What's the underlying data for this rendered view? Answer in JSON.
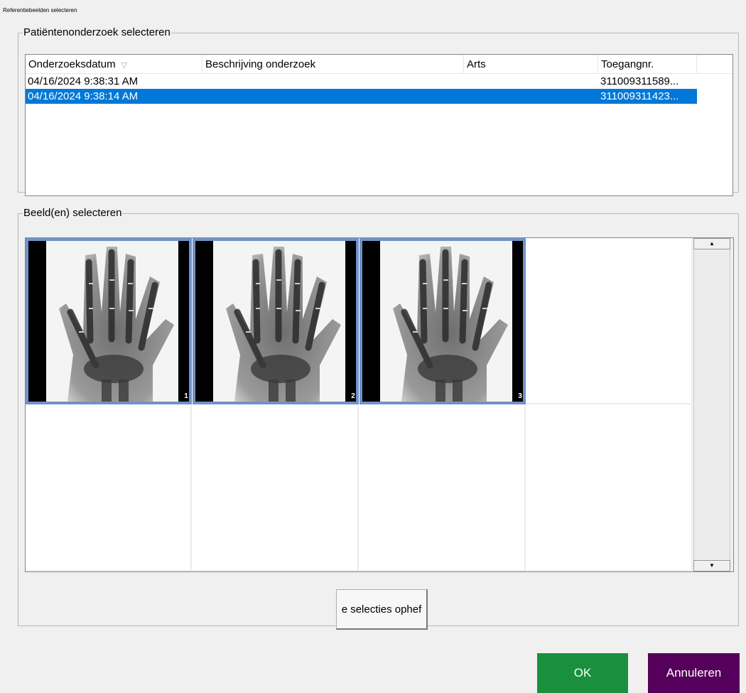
{
  "window": {
    "title": "Referentiebeelden selecteren"
  },
  "study_group": {
    "legend": "Patiëntenonderzoek selecteren",
    "columns": [
      {
        "label": "Onderzoeksdatum",
        "sort_icon": "sort-descending-icon"
      },
      {
        "label": "Beschrijving onderzoek"
      },
      {
        "label": "Arts"
      },
      {
        "label": "Toegangnr."
      }
    ],
    "rows": [
      {
        "date": "04/16/2024 9:38:31 AM",
        "description": "",
        "physician": "",
        "accession": "311009311589...",
        "selected": false
      },
      {
        "date": "04/16/2024 9:38:14 AM",
        "description": "",
        "physician": "",
        "accession": "311009311423...",
        "selected": true
      }
    ]
  },
  "image_group": {
    "legend": "Beeld(en) selecteren",
    "tiles": [
      {
        "index_label": "1",
        "has_image": true,
        "image": "hand-xray"
      },
      {
        "index_label": "2",
        "has_image": true,
        "image": "hand-xray"
      },
      {
        "index_label": "3",
        "has_image": true,
        "image": "hand-xray"
      }
    ],
    "clear_button_label": "e selecties ophef"
  },
  "footer": {
    "ok_label": "OK",
    "cancel_label": "Annuleren",
    "ok_color": "#1a8f3e",
    "cancel_color": "#55005a",
    "selection_color": "#0078d7"
  }
}
